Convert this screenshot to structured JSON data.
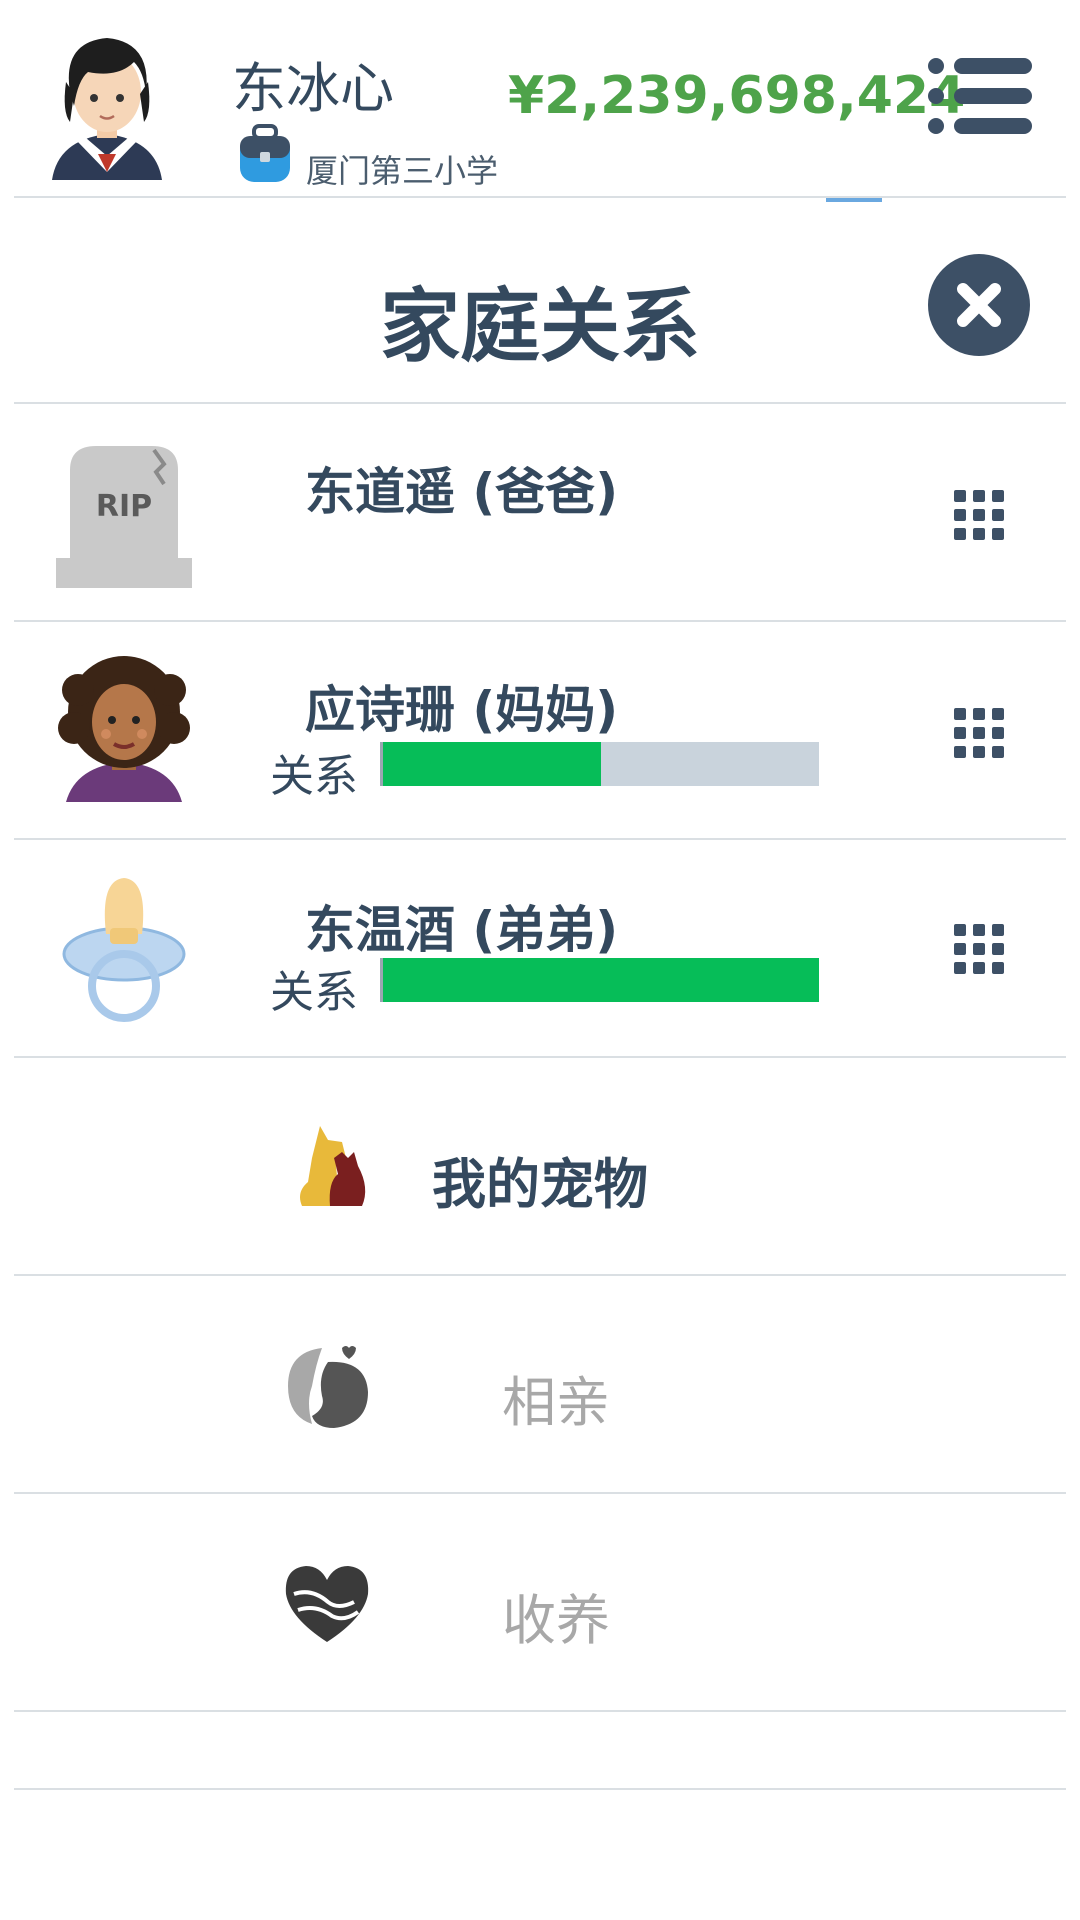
{
  "header": {
    "player_name": "东冰心",
    "school": "厦门第三小学",
    "money": "¥2,239,698,424"
  },
  "title": "家庭关系",
  "family": [
    {
      "name": "东道遥 (爸爸)",
      "deceased": true,
      "rip_text": "RIP",
      "icon": "tombstone-icon"
    },
    {
      "name": "应诗珊 (妈妈)",
      "relation_label": "关系",
      "relation_value": 0.5,
      "icon": "mother-avatar-icon"
    },
    {
      "name": "东温酒 (弟弟)",
      "relation_label": "关系",
      "relation_value": 1.0,
      "icon": "pacifier-icon"
    }
  ],
  "options": [
    {
      "label": "我的宠物",
      "enabled": true,
      "icon": "pets-icon"
    },
    {
      "label": "相亲",
      "enabled": false,
      "icon": "couple-icon"
    },
    {
      "label": "收养",
      "enabled": false,
      "icon": "adopt-heart-icon"
    }
  ],
  "colors": {
    "text": "#34495e",
    "money": "#4ea34a",
    "bar_fill": "#06bd58",
    "bar_track": "#c9d3dc",
    "disabled": "#a8a8a8"
  }
}
